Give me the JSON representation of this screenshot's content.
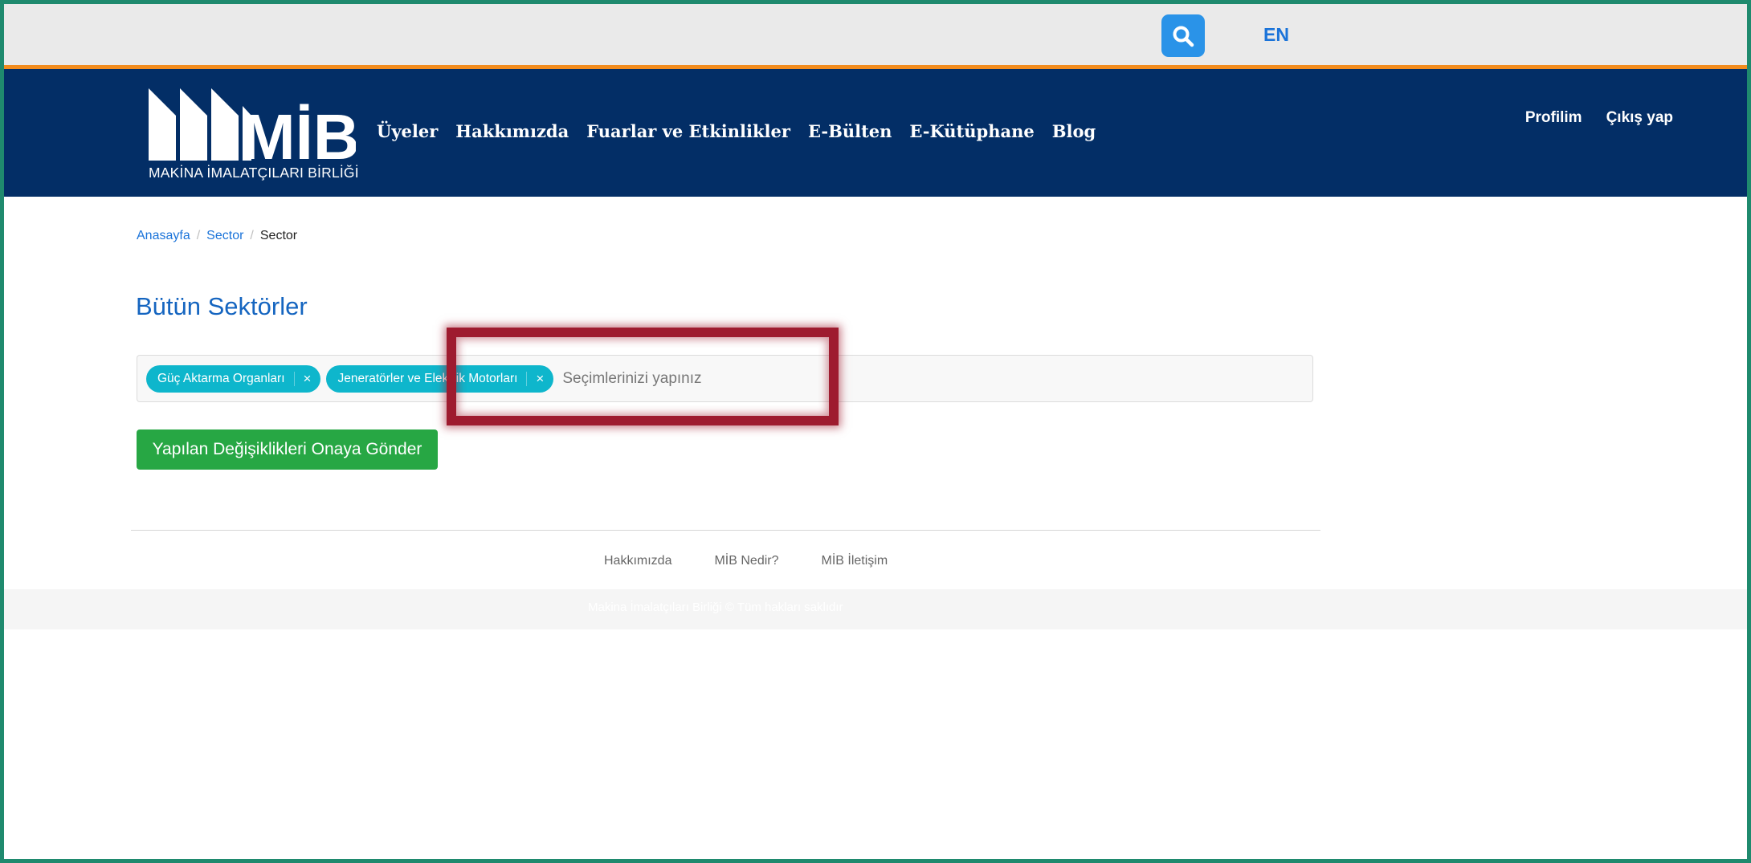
{
  "topbar": {
    "search_icon": "search-icon",
    "language": "EN"
  },
  "brand": {
    "logo_text": "MİB",
    "logo_subtitle": "MAKİNA İMALATÇILARI BİRLİĞİ"
  },
  "nav": {
    "items": [
      "Üyeler",
      "Hakkımızda",
      "Fuarlar ve Etkinlikler",
      "E-Bülten",
      "E-Kütüphane",
      "Blog"
    ],
    "profile": "Profilim",
    "logout": "Çıkış yap"
  },
  "breadcrumb": {
    "items": [
      "Anasayfa",
      "Sector"
    ],
    "current": "Sector"
  },
  "page": {
    "title": "Bütün Sektörler"
  },
  "selector": {
    "tags": [
      "Güç Aktarma Organları",
      "Jeneratörler ve Elektrik Motorları"
    ],
    "remove_symbol": "×",
    "placeholder": "Seçimlerinizi yapınız"
  },
  "actions": {
    "submit_label": "Yapılan Değişiklikleri Onaya Gönder"
  },
  "footer": {
    "links": [
      "Hakkımızda",
      "MİB Nedir?",
      "MİB İletişim"
    ],
    "copyright": "Makina İmalatçıları Birliği © Tüm hakları saklıdır"
  },
  "colors": {
    "navbar": "#032e66",
    "accent_orange": "#f28c1e",
    "tag": "#0eb6cc",
    "submit": "#27a744",
    "highlight": "#9e1b2f"
  }
}
